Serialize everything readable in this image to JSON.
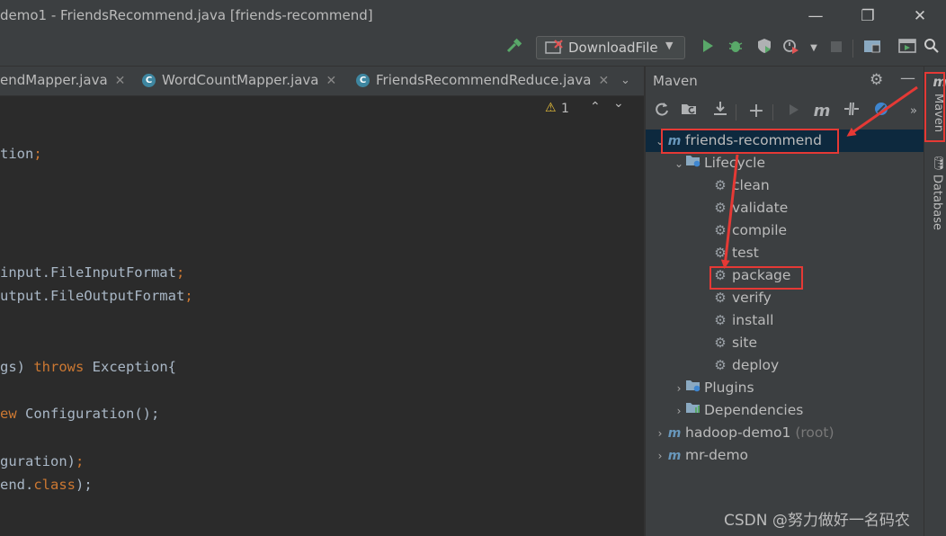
{
  "window": {
    "title": "demo1 - FriendsRecommend.java [friends-recommend]",
    "minimize": "—",
    "restore": "❐",
    "close": "✕"
  },
  "toolbar": {
    "run_config": "DownloadFile"
  },
  "tabs": [
    {
      "label": "endMapper.java"
    },
    {
      "label": "WordCountMapper.java"
    },
    {
      "label": "FriendsRecommendReduce.java"
    }
  ],
  "editor": {
    "warning_count": "1",
    "lines": [
      {
        "pre": "tion",
        "kw": "",
        "post": ";"
      },
      {
        "pre": "input.FileInputFormat",
        "kw": "",
        "post": ";"
      },
      {
        "pre": "utput.FileOutputFormat",
        "kw": "",
        "post": ";"
      },
      {
        "pre": "gs) ",
        "kw": "throws",
        "post": " Exception{"
      },
      {
        "pre": "ew",
        "kw": "",
        "post": " Configuration();"
      },
      {
        "pre": "guration)",
        "kw": "",
        "post": ";"
      },
      {
        "pre": "end.",
        "kw": "class",
        "post": ");"
      }
    ]
  },
  "maven": {
    "title": "Maven",
    "tree": {
      "project1": "friends-recommend",
      "lifecycle": "Lifecycle",
      "phases": [
        "clean",
        "validate",
        "compile",
        "test",
        "package",
        "verify",
        "install",
        "site",
        "deploy"
      ],
      "plugins": "Plugins",
      "dependencies": "Dependencies",
      "project2": "hadoop-demo1",
      "project2_suffix": "(root)",
      "project3": "mr-demo"
    }
  },
  "sidebar": {
    "maven_tab": "Maven",
    "database_tab": "Database"
  },
  "watermark": "CSDN @努力做好一名码农",
  "colors": {
    "background": "#2b2b2b",
    "panel": "#3c3f41",
    "selection": "#0d293e",
    "highlight_red": "#e53935",
    "keyword": "#cc7832"
  }
}
